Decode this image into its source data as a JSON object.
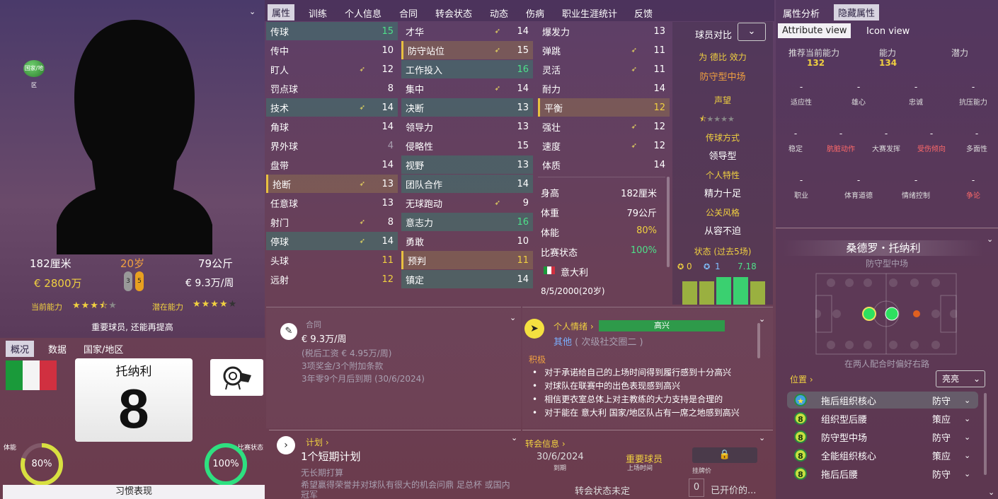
{
  "profile": {
    "height": "182厘米",
    "age": "20岁",
    "weight": "79公斤",
    "value": "€ 2800万",
    "wage": "€ 9.3万/周",
    "foot_left": "3",
    "foot_right": "5",
    "current_ability_label": "当前能力",
    "potential_ability_label": "潜在能力",
    "current_stars": 3.5,
    "potential_stars": 4,
    "status_note": "重要球员, 还能再提高",
    "nation_badge": "国家/地区"
  },
  "left_tabs": [
    "概况",
    "数据",
    "国家/地区"
  ],
  "kit": {
    "name": "托纳利",
    "number": "8"
  },
  "gauges": {
    "fitness_label": "体能",
    "fitness_value": "80%",
    "match_label": "比赛状态",
    "match_value": "100%",
    "fitness_frac": 0.8,
    "match_frac": 1.0
  },
  "habit_button": "习惯表现",
  "tabs": [
    "属性",
    "训练",
    "个人信息",
    "合同",
    "转会状态",
    "动态",
    "伤病",
    "职业生涯统计",
    "反馈"
  ],
  "attr_col1": [
    {
      "n": "传球",
      "v": "15"
    },
    {
      "n": "传中",
      "v": "10"
    },
    {
      "n": "盯人",
      "v": "12"
    },
    {
      "n": "罚点球",
      "v": "8"
    },
    {
      "n": "技术",
      "v": "14"
    },
    {
      "n": "角球",
      "v": "14"
    },
    {
      "n": "界外球",
      "v": "4"
    },
    {
      "n": "盘带",
      "v": "14"
    },
    {
      "n": "抢断",
      "v": "13"
    },
    {
      "n": "任意球",
      "v": "13"
    },
    {
      "n": "射门",
      "v": "8"
    },
    {
      "n": "停球",
      "v": "14"
    },
    {
      "n": "头球",
      "v": "11"
    },
    {
      "n": "远射",
      "v": "12"
    }
  ],
  "attr_col2": [
    {
      "n": "才华",
      "v": "14"
    },
    {
      "n": "防守站位",
      "v": "15"
    },
    {
      "n": "工作投入",
      "v": "16"
    },
    {
      "n": "集中",
      "v": "14"
    },
    {
      "n": "决断",
      "v": "13"
    },
    {
      "n": "领导力",
      "v": "13"
    },
    {
      "n": "侵略性",
      "v": "15"
    },
    {
      "n": "视野",
      "v": "13"
    },
    {
      "n": "团队合作",
      "v": "14"
    },
    {
      "n": "无球跑动",
      "v": "9"
    },
    {
      "n": "意志力",
      "v": "16"
    },
    {
      "n": "勇敢",
      "v": "10"
    },
    {
      "n": "预判",
      "v": "11"
    },
    {
      "n": "镇定",
      "v": "14"
    }
  ],
  "attr_col3": [
    {
      "n": "爆发力",
      "v": "13"
    },
    {
      "n": "弹跳",
      "v": "11"
    },
    {
      "n": "灵活",
      "v": "11"
    },
    {
      "n": "耐力",
      "v": "14"
    },
    {
      "n": "平衡",
      "v": "12"
    },
    {
      "n": "强壮",
      "v": "12"
    },
    {
      "n": "速度",
      "v": "12"
    },
    {
      "n": "体质",
      "v": "14"
    }
  ],
  "bio": [
    {
      "n": "身高",
      "v": "182厘米"
    },
    {
      "n": "体重",
      "v": "79公斤"
    },
    {
      "n": "体能",
      "v": "80%"
    },
    {
      "n": "比赛状态",
      "v": "100%"
    }
  ],
  "nationality": "意大利",
  "birth": "8/5/2000(20岁)",
  "compare": {
    "title": "球员对比",
    "playing_for": "为 德比 效力",
    "position": "防守型中场",
    "reputation_label": "声望",
    "pass_style_label": "传球方式",
    "pass_style": "领导型",
    "trait_label": "个人特性",
    "trait": "精力十足",
    "media_label": "公关风格",
    "media": "从容不迫",
    "form_label": "状态 (过去5场)",
    "goals": "0",
    "assists": "1",
    "rating": "7.18",
    "form_bars": [
      0.55,
      0.55,
      0.65,
      0.65,
      0.55
    ]
  },
  "contract": {
    "title": "合同",
    "wage": "€ 9.3万/周",
    "after_tax": "(税后工资 € 4.95万/周)",
    "bonus": "3项奖金/3个附加条款",
    "expiry": "3年零9个月后到期 (30/6/2024)"
  },
  "plan": {
    "title": "计划",
    "headline": "1个短期计划",
    "line1": "无长期打算",
    "line2": "希望赢得荣誉并对球队有很大的机会问鼎 足总杯 或国内冠军"
  },
  "mood": {
    "title": "个人情绪",
    "status": "高兴",
    "other": "其他",
    "other_note": "( 次级社交圈二 )",
    "positive_label": "积极",
    "items": [
      "对于承诺给自己的上场时间得到履行感到十分高兴",
      "对球队在联赛中的出色表现感到高兴",
      "相信更衣室总体上对主教练的大力支持是合理的",
      "对于能在 意大利 国家/地区队占有一席之地感到高兴"
    ]
  },
  "transfer": {
    "title": "转会信息",
    "expiry_date": "30/6/2024",
    "expiry_label": "到期",
    "squad_status": "重要球员",
    "squad_label": "上场时间",
    "price_label": "挂牌价",
    "status": "转会状态未定",
    "offers_count": "0",
    "offers_label": "已开价的..."
  },
  "right_tabs": [
    "属性分析",
    "隐藏属性"
  ],
  "view_tabs": [
    "Attribute view",
    "Icon view"
  ],
  "hidden": {
    "rec_label": "推荐当前能力",
    "rec_value": "132",
    "ability_label": "能力",
    "ability_value": "134",
    "potential_label": "潜力",
    "row1": [
      "适应性",
      "雄心",
      "忠诚",
      "抗压能力"
    ],
    "row2": [
      "稳定",
      "肮脏动作",
      "大赛发挥",
      "受伤倾向",
      "多面性"
    ],
    "row3": [
      "职业",
      "体育道德",
      "情绪控制",
      "争论"
    ],
    "dash": "-"
  },
  "player_card": {
    "name": "桑德罗・托纳利",
    "position": "防守型中场",
    "note": "在两人配合时偏好右路",
    "positions_label": "位置",
    "display_mode": "亮亮",
    "roles": [
      {
        "name": "拖后组织核心",
        "duty": "防守",
        "rating": "★"
      },
      {
        "name": "组织型后腰",
        "duty": "策应",
        "rating": "8"
      },
      {
        "name": "防守型中场",
        "duty": "防守",
        "rating": "8"
      },
      {
        "name": "全能组织核心",
        "duty": "策应",
        "rating": "8"
      },
      {
        "name": "拖后后腰",
        "duty": "防守",
        "rating": "8"
      }
    ]
  }
}
